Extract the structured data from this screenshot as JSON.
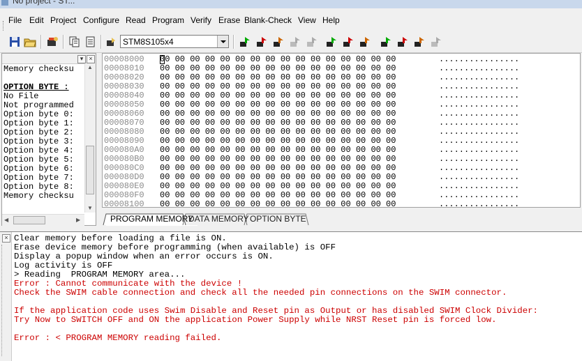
{
  "window": {
    "title": "No project - ST..."
  },
  "menu": {
    "items": [
      {
        "label": "File",
        "name": "menu-file"
      },
      {
        "label": "Edit",
        "name": "menu-edit"
      },
      {
        "label": "Project",
        "name": "menu-project"
      },
      {
        "label": "Configure",
        "name": "menu-configure"
      },
      {
        "label": "Read",
        "name": "menu-read"
      },
      {
        "label": "Program",
        "name": "menu-program"
      },
      {
        "label": "Verify",
        "name": "menu-verify"
      },
      {
        "label": "Erase",
        "name": "menu-erase"
      },
      {
        "label": "Blank-Check",
        "name": "menu-blank-check"
      },
      {
        "label": "View",
        "name": "menu-view"
      },
      {
        "label": "Help",
        "name": "menu-help"
      }
    ]
  },
  "toolbar": {
    "device": "STM8S105x4",
    "icons": [
      "save-icon",
      "open-folder-icon",
      "programmer-icon",
      "copy-icon",
      "paste-icon",
      "device-select-icon",
      "read-all-icon",
      "read-current-icon",
      "read-option-icon",
      "read-disabled-icon",
      "read-disabled-2-icon",
      "program-all-icon",
      "program-current-icon",
      "program-option-icon",
      "verify-all-icon",
      "verify-current-icon",
      "verify-option-icon",
      "verify-disabled-icon"
    ]
  },
  "left_panel": {
    "lines": [
      "Memory checksu",
      "",
      "OPTION BYTE :",
      "No File",
      "Not programmed",
      "Option byte 0:",
      "Option byte 1:",
      "Option byte 2:",
      "Option byte 3:",
      "Option byte 4:",
      "Option byte 5:",
      "Option byte 6:",
      "Option byte 7:",
      "Option byte 8:",
      "Memory checksu"
    ]
  },
  "hex_view": {
    "rows": [
      {
        "addr": "00008000",
        "bytes": "00 00 00 00 00 00 00 00 00 00 00 00 00 00 00 00",
        "ascii": "................"
      },
      {
        "addr": "00008010",
        "bytes": "00 00 00 00 00 00 00 00 00 00 00 00 00 00 00 00",
        "ascii": "................"
      },
      {
        "addr": "00008020",
        "bytes": "00 00 00 00 00 00 00 00 00 00 00 00 00 00 00 00",
        "ascii": "................"
      },
      {
        "addr": "00008030",
        "bytes": "00 00 00 00 00 00 00 00 00 00 00 00 00 00 00 00",
        "ascii": "................"
      },
      {
        "addr": "00008040",
        "bytes": "00 00 00 00 00 00 00 00 00 00 00 00 00 00 00 00",
        "ascii": "................"
      },
      {
        "addr": "00008050",
        "bytes": "00 00 00 00 00 00 00 00 00 00 00 00 00 00 00 00",
        "ascii": "................"
      },
      {
        "addr": "00008060",
        "bytes": "00 00 00 00 00 00 00 00 00 00 00 00 00 00 00 00",
        "ascii": "................"
      },
      {
        "addr": "00008070",
        "bytes": "00 00 00 00 00 00 00 00 00 00 00 00 00 00 00 00",
        "ascii": "................"
      },
      {
        "addr": "00008080",
        "bytes": "00 00 00 00 00 00 00 00 00 00 00 00 00 00 00 00",
        "ascii": "................"
      },
      {
        "addr": "00008090",
        "bytes": "00 00 00 00 00 00 00 00 00 00 00 00 00 00 00 00",
        "ascii": "................"
      },
      {
        "addr": "000080A0",
        "bytes": "00 00 00 00 00 00 00 00 00 00 00 00 00 00 00 00",
        "ascii": "................"
      },
      {
        "addr": "000080B0",
        "bytes": "00 00 00 00 00 00 00 00 00 00 00 00 00 00 00 00",
        "ascii": "................"
      },
      {
        "addr": "000080C0",
        "bytes": "00 00 00 00 00 00 00 00 00 00 00 00 00 00 00 00",
        "ascii": "................"
      },
      {
        "addr": "000080D0",
        "bytes": "00 00 00 00 00 00 00 00 00 00 00 00 00 00 00 00",
        "ascii": "................"
      },
      {
        "addr": "000080E0",
        "bytes": "00 00 00 00 00 00 00 00 00 00 00 00 00 00 00 00",
        "ascii": "................"
      },
      {
        "addr": "000080F0",
        "bytes": "00 00 00 00 00 00 00 00 00 00 00 00 00 00 00 00",
        "ascii": "................"
      },
      {
        "addr": "00008100",
        "bytes": "00 00 00 00 00 00 00 00 00 00 00 00 00 00 00 00",
        "ascii": "................"
      }
    ]
  },
  "tabs": [
    {
      "label": "PROGRAM MEMORY",
      "active": true
    },
    {
      "label": "DATA MEMORY",
      "active": false
    },
    {
      "label": "OPTION BYTE",
      "active": false
    }
  ],
  "log": {
    "lines": [
      {
        "text": "Clear memory before loading a file is ON.",
        "type": "normal"
      },
      {
        "text": "Erase device memory before programming (when available) is OFF",
        "type": "normal"
      },
      {
        "text": "Display a popup window when an error occurs is ON.",
        "type": "normal"
      },
      {
        "text": "Log activity is OFF",
        "type": "normal"
      },
      {
        "text": "> Reading  PROGRAM MEMORY area...",
        "type": "normal"
      },
      {
        "text": "Error : Cannot communicate with the device !",
        "type": "error"
      },
      {
        "text": "Check the SWIM cable connection and check all the needed pin connections on the SWIM connector.",
        "type": "error"
      },
      {
        "text": "",
        "type": "normal"
      },
      {
        "text": "If the application code uses Swim Disable and Reset pin as Output or has disabled SWIM Clock Divider: ",
        "type": "error"
      },
      {
        "text": "Try Now to SWITCH OFF and ON the application Power Supply while NRST Reset pin is forced low.",
        "type": "error"
      },
      {
        "text": "",
        "type": "normal"
      },
      {
        "text": "Error : < PROGRAM MEMORY reading failed.",
        "type": "error"
      }
    ]
  },
  "colors": {
    "error": "#cc0000",
    "address": "#8a8a8a"
  }
}
